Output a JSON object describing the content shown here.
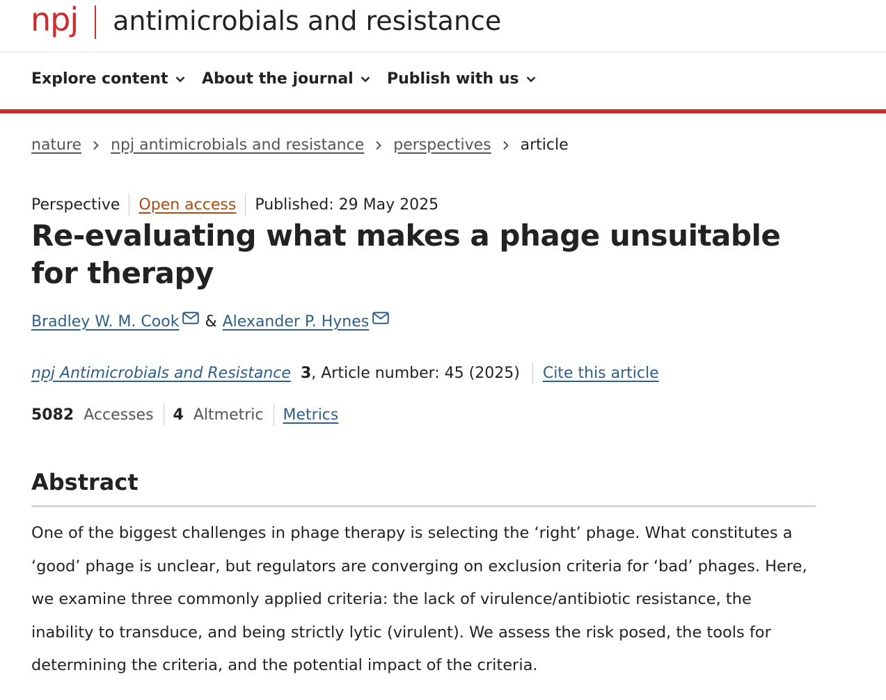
{
  "masthead": {
    "brand": "npj",
    "journal_name": "antimicrobials and resistance"
  },
  "nav": {
    "items": [
      {
        "label": "Explore content"
      },
      {
        "label": "About the journal"
      },
      {
        "label": "Publish with us"
      }
    ]
  },
  "breadcrumb": {
    "items": [
      "nature",
      "npj antimicrobials and resistance",
      "perspectives"
    ],
    "current": "article"
  },
  "article": {
    "type": "Perspective",
    "open_access": "Open access",
    "published": "Published: 29 May 2025",
    "title": "Re-evaluating what makes a phage unsuitable for therapy",
    "authors": [
      "Bradley W. M. Cook",
      "Alexander P. Hynes"
    ],
    "author_separator": "&",
    "journal": "npj Antimicrobials and Resistance",
    "volume": "3",
    "article_number": ", Article number: 45 (2025)",
    "cite_label": "Cite this article"
  },
  "metrics": {
    "accesses_count": "5082",
    "accesses_label": "Accesses",
    "altmetric_count": "4",
    "altmetric_label": "Altmetric",
    "metrics_link": "Metrics"
  },
  "abstract": {
    "heading": "Abstract",
    "text": "One of the biggest challenges in phage therapy is selecting the ‘right’ phage. What constitutes a ‘good’ phage is unclear, but regulators are converging on exclusion criteria for ‘bad’ phages. Here, we examine three commonly applied criteria: the lack of virulence/antibiotic resistance, the inability to transduce, and being strictly lytic (virulent). We assess the risk posed, the tools for determining the criteria, and the potential impact of the criteria."
  },
  "colors": {
    "brand_red": "#cc2c2c",
    "nav_rule": "#c8312c",
    "link_blue": "#2e5e8c",
    "open_access_orange": "#b04a12"
  },
  "icons": {
    "nav_dropdown": "chevron-down-icon",
    "breadcrumb_separator": "chevron-right-icon",
    "author_contact": "mail-icon"
  }
}
